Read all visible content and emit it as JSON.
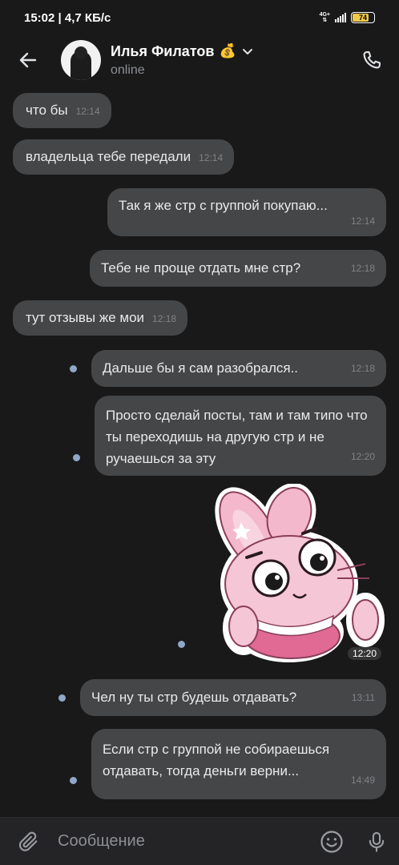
{
  "status_bar": {
    "time_speed": "15:02 | 4,7 КБ/с",
    "network": "4G+",
    "battery": "74",
    "battery_color": "#f2c94c"
  },
  "header": {
    "back_icon": "arrow-left-icon",
    "name": "Илья Филатов",
    "name_emoji": "💰",
    "chevron_icon": "chevron-down-icon",
    "status": "online",
    "call_icon": "phone-icon"
  },
  "messages": [
    {
      "direction": "in",
      "text": "что бы",
      "time": "12:14"
    },
    {
      "direction": "in",
      "text": "владельца тебе передали",
      "time": "12:14"
    },
    {
      "direction": "out",
      "text": "Так я же стр с группой покупаю...",
      "time": "12:14"
    },
    {
      "direction": "out",
      "text": "Тебе не проще отдать мне стр?",
      "time": "12:18"
    },
    {
      "direction": "in",
      "text": "тут отзывы же мои",
      "time": "12:18"
    },
    {
      "direction": "out",
      "text": "Дальше бы я сам разобрался..",
      "time": "12:18",
      "unread": true
    },
    {
      "direction": "out",
      "text": "Просто сделай посты, там и там типо что ты переходишь на другую стр и не ручаешься за эту",
      "time": "12:20",
      "unread": true
    },
    {
      "direction": "out",
      "type": "sticker",
      "sticker": "pink-bunny-shrug",
      "time": "12:20",
      "unread": true
    },
    {
      "direction": "out",
      "text": "Чел ну ты стр будешь отдавать?",
      "time": "13:11",
      "unread": true
    },
    {
      "direction": "out",
      "text": "Если стр с группой не собираешься отдавать, тогда деньги верни...",
      "time": "14:49",
      "unread": true
    }
  ],
  "composer": {
    "placeholder": "Сообщение",
    "attach_icon": "paperclip-icon",
    "emoji_icon": "smile-icon",
    "mic_icon": "microphone-icon"
  },
  "colors": {
    "background": "#19191a",
    "bubble": "#454647",
    "unread_dot": "#8fa8c8",
    "sticker_pink": "#f4b8cc"
  }
}
